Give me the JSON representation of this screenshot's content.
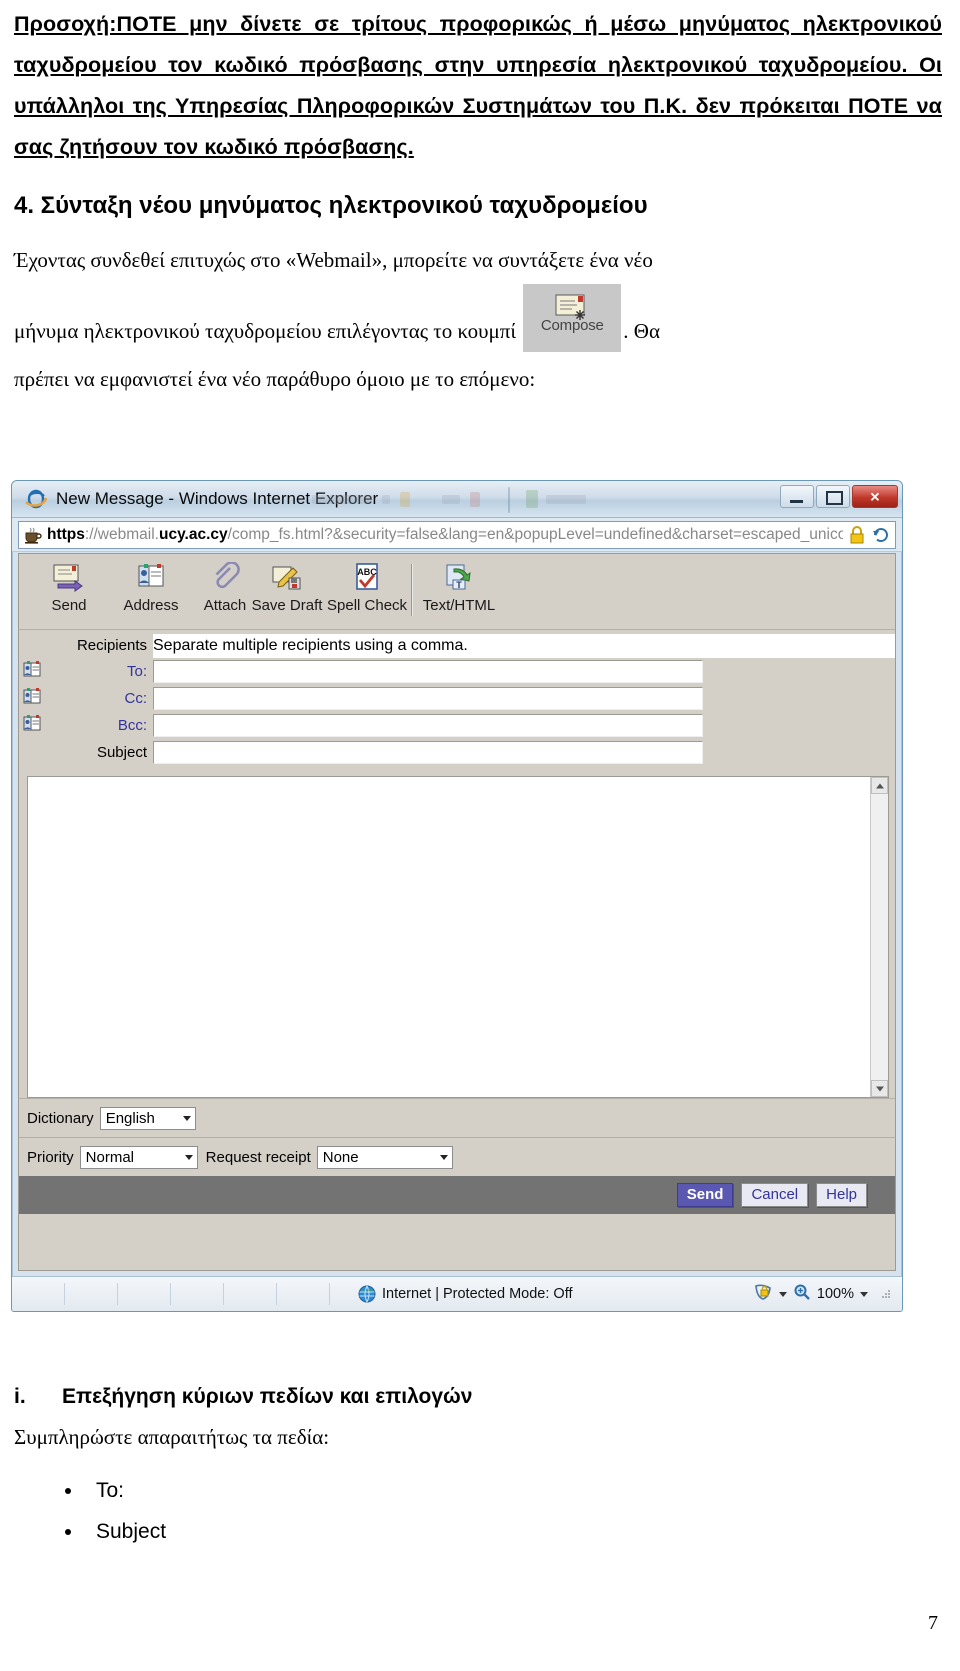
{
  "document": {
    "warning_paragraph": "Προσοχή:ΠΟΤΕ μην δίνετε σε τρίτους προφορικώς ή μέσω μηνύματος ηλεκτρονικού ταχυδρομείου τον κωδικό πρόσβασης στην υπηρεσία ηλεκτρονικού ταχυδρομείου. Οι υπάλληλοι της Υπηρεσίας Πληροφορικών Συστημάτων του Π.Κ. δεν πρόκειται ΠΟΤΕ να σας ζητήσουν τον κωδικό πρόσβασης.",
    "section_heading": "4. Σύνταξη νέου μηνύματος ηλεκτρονικού ταχυδρομείου",
    "body_part1": "Έχοντας συνδεθεί επιτυχώς στο «Webmail», μπορείτε να συντάξετε ένα νέο",
    "body_part2": "μήνυμα ηλεκτρονικού ταχυδρομείου επιλέγοντας το κουμπί",
    "body_part3": ". Θα",
    "body_part4": "πρέπει να εμφανιστεί ένα νέο παράθυρο όμοιο με το επόμενο:",
    "compose_button_label": "Compose",
    "subsection_number": "i.",
    "subsection_heading": "Επεξήγηση κύριων πεδίων και επιλογών",
    "subsection_intro": "Συμπληρώστε απαραιτήτως τα πεδία:",
    "bullets": [
      "To:",
      "Subject"
    ],
    "page_number": "7"
  },
  "browser": {
    "title": "New Message - Windows Internet Explorer",
    "url_secure": "https",
    "url_sep": "://webmail.",
    "url_domain": "ucy.ac.cy",
    "url_path": "/comp_fs.html?&security=false&lang=en&popupLevel=undefined&charset=escaped_unicode",
    "minimize_label": "Minimize",
    "maximize_label": "Maximize",
    "close_label": "✕",
    "status": {
      "zone": "Internet | Protected Mode: Off",
      "zoom": "100%"
    }
  },
  "webmail": {
    "toolbar": [
      {
        "label": "Send",
        "icon": "send-envelope-icon"
      },
      {
        "label": "Address",
        "icon": "address-book-icon"
      },
      {
        "label": "Attach",
        "icon": "paperclip-icon"
      },
      {
        "label": "Save Draft",
        "icon": "save-draft-icon"
      },
      {
        "label": "Spell Check",
        "icon": "spell-check-icon"
      },
      {
        "label": "Text/HTML",
        "icon": "text-html-toggle-icon"
      }
    ],
    "recipients_label": "Recipients",
    "recipients_hint": "Separate multiple recipients using a comma.",
    "fields": [
      {
        "label": "To:",
        "value": ""
      },
      {
        "label": "Cc:",
        "value": ""
      },
      {
        "label": "Bcc:",
        "value": ""
      }
    ],
    "subject_label": "Subject",
    "subject_value": "",
    "dictionary_label": "Dictionary",
    "dictionary_value": "English",
    "priority_label": "Priority",
    "priority_value": "Normal",
    "receipt_label": "Request receipt",
    "receipt_value": "None",
    "buttons": {
      "send": "Send",
      "cancel": "Cancel",
      "help": "Help"
    }
  },
  "colors": {
    "send_button_bg": "#5a58b0",
    "button_text": "#33339a",
    "chrome_face": "#d4d0c8",
    "button_bar": "#737373"
  }
}
